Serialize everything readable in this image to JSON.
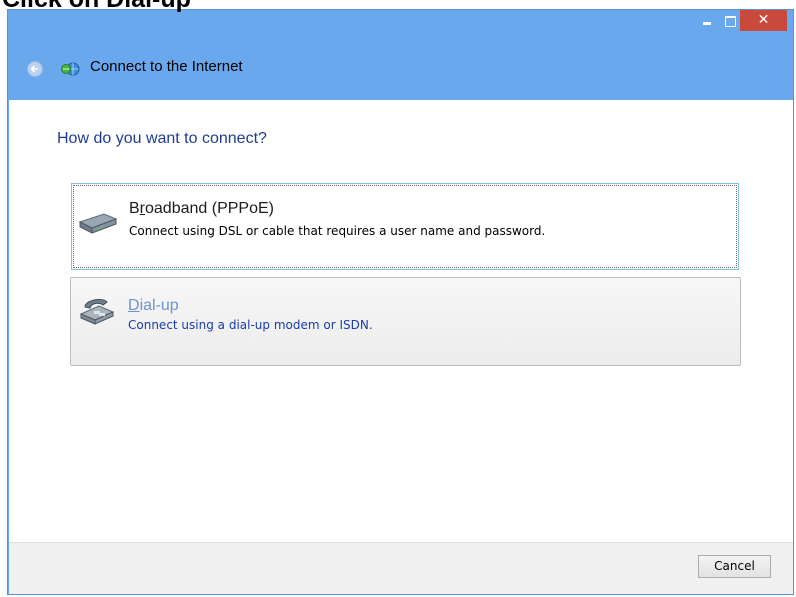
{
  "caption": {
    "text": "Click on Dial-up"
  },
  "window": {
    "controls": {
      "close_glyph": "✕"
    }
  },
  "header": {
    "title": "Connect to the Internet",
    "back_icon": "back-arrow-icon",
    "app_icon": "network-connect-icon"
  },
  "main": {
    "question": "How do you want to connect?",
    "options": [
      {
        "title_prefix": "B",
        "title_accel": "r",
        "title_rest": "oadband (PPPoE)",
        "description": "Connect using DSL or cable that requires a user name and password.",
        "icon": "broadband-modem-icon"
      },
      {
        "title_accel": "D",
        "title_rest": "ial-up",
        "description": "Connect using a dial-up modem or ISDN.",
        "icon": "dialup-modem-icon"
      }
    ]
  },
  "footer": {
    "cancel_label": "Cancel"
  },
  "colors": {
    "titlebar": "#6aa8ee",
    "close_button": "#c94a3d",
    "question_text": "#1e3d8f",
    "dialup_title": "#6d93d6",
    "dialup_description": "#1a3da8"
  }
}
